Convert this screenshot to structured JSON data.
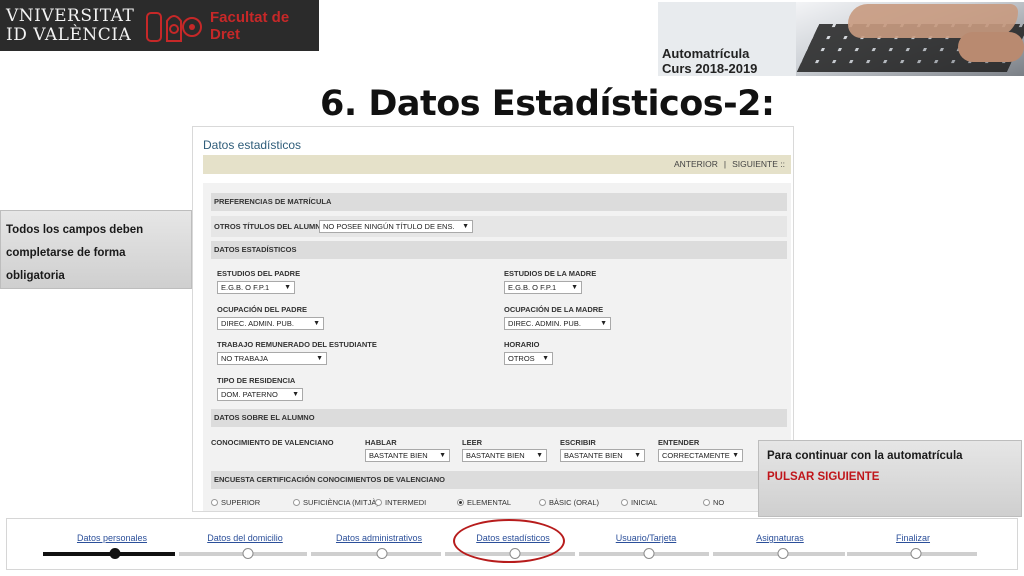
{
  "header": {
    "university": [
      "VNIVERSITAT",
      "ID VALÈNCIA"
    ],
    "faculty": [
      "Facultat de",
      "Dret"
    ],
    "banner_lines": [
      "Automatrícula",
      "Curs 2018-2019"
    ]
  },
  "slide_title": "6. Datos Estadísticos-2:",
  "panel": {
    "title": "Datos estadísticos",
    "nav": {
      "prev": "ANTERIOR",
      "separator": "|",
      "next": "SIGUIENTE ::"
    },
    "sections": {
      "preferencias": "PREFERENCIAS DE MATRÍCULA",
      "estadisticos": "DATOS ESTADÍSTICOS",
      "alumno": "DATOS SOBRE EL ALUMNO",
      "encuesta": "ENCUESTA CERTIFICACIÓN CONOCIMIENTOS DE VALENCIANO"
    },
    "otros_titulos": {
      "label": "OTROS TÍTULOS DEL ALUMNO",
      "value": "NO POSEE NINGÚN TÍTULO DE ENS."
    },
    "fields": {
      "estudios_padre": {
        "label": "ESTUDIOS DEL PADRE",
        "value": "E.G.B. O F.P.1"
      },
      "estudios_madre": {
        "label": "ESTUDIOS DE LA MADRE",
        "value": "E.G.B. O F.P.1"
      },
      "ocupacion_padre": {
        "label": "OCUPACIÓN DEL PADRE",
        "value": "DIREC. ADMIN. PUB."
      },
      "ocupacion_madre": {
        "label": "OCUPACIÓN DE LA MADRE",
        "value": "DIREC. ADMIN. PUB."
      },
      "trabajo": {
        "label": "TRABAJO REMUNERADO DEL ESTUDIANTE",
        "value": "NO TRABAJA"
      },
      "horario": {
        "label": "HORARIO",
        "value": "OTROS"
      },
      "residencia": {
        "label": "TIPO DE RESIDENCIA",
        "value": "DOM. PATERNO"
      }
    },
    "valenciano": {
      "label": "CONOCIMIENTO DE VALENCIANO",
      "hablar": {
        "label": "HABLAR",
        "value": "BASTANTE BIEN"
      },
      "leer": {
        "label": "LEER",
        "value": "BASTANTE BIEN"
      },
      "escribir": {
        "label": "ESCRIBIR",
        "value": "BASTANTE BIEN"
      },
      "entender": {
        "label": "ENTENDER",
        "value": "CORRECTAMENTE"
      }
    },
    "encuesta_options": [
      "SUPERIOR",
      "SUFICIÈNCIA (MITJÀ)",
      "INTERMEDI",
      "ELEMENTAL",
      "BÀSIC (ORAL)",
      "INICIAL",
      "NO"
    ],
    "encuesta_selected": "ELEMENTAL",
    "arrow_glyph": "▼"
  },
  "note_left": {
    "lines": [
      "Todos los campos deben",
      "completarse de forma",
      "obligatoria"
    ]
  },
  "note_right": {
    "line1": "Para continuar con la automatrícula",
    "line2": "PULSAR SIGUIENTE"
  },
  "steps": {
    "items": [
      "Datos personales",
      "Datos del domicilio",
      "Datos administrativos",
      "Datos estadísticos",
      "Usuario/Tarjeta",
      "Asignaturas",
      "Finalizar"
    ],
    "current": "Datos personales",
    "highlighted": "Datos estadísticos"
  },
  "colors": {
    "accent_red": "#c0161b",
    "link_blue": "#2b4f9a",
    "nav_band": "#e5e1c9",
    "header_bg": "#2b2b2b"
  }
}
